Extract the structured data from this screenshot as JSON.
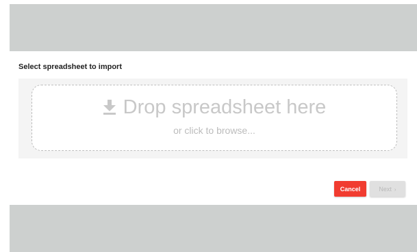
{
  "dialog": {
    "title": "Select spreadsheet to import"
  },
  "dropzone": {
    "icon": "download-icon",
    "heading": "Drop spreadsheet here",
    "subtext": "or click to browse..."
  },
  "actions": {
    "cancel_label": "Cancel",
    "next_label": "Next",
    "next_chevron": "›"
  },
  "colors": {
    "cancel_button": "#f13c30",
    "disabled_button": "#e0e0e0",
    "band": "#cdd0cf"
  }
}
